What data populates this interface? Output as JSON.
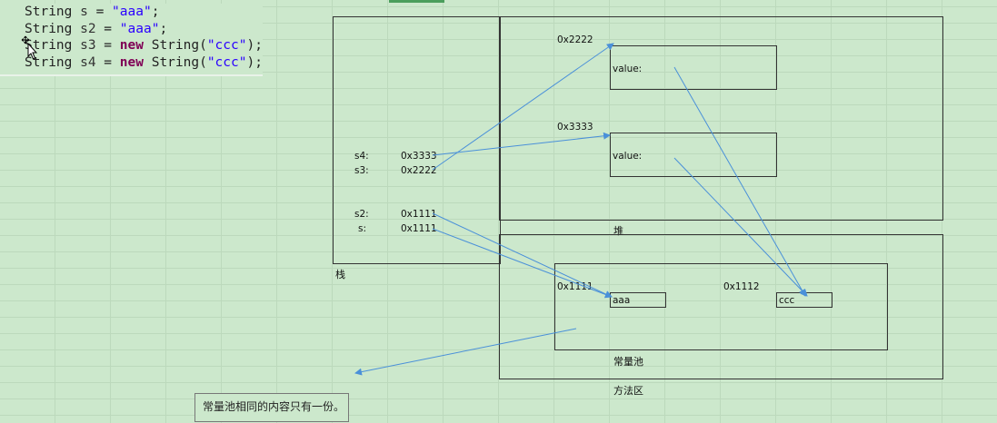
{
  "code": {
    "lines": [
      [
        {
          "t": "String ",
          "c": ""
        },
        {
          "t": "s",
          "c": "var"
        },
        {
          "t": " = ",
          "c": ""
        },
        {
          "t": "\"aaa\"",
          "c": "str"
        },
        {
          "t": ";",
          "c": ""
        }
      ],
      [
        {
          "t": "String ",
          "c": ""
        },
        {
          "t": "s2",
          "c": "var"
        },
        {
          "t": " = ",
          "c": ""
        },
        {
          "t": "\"aaa\"",
          "c": "str"
        },
        {
          "t": ";",
          "c": ""
        }
      ],
      [
        {
          "t": "String ",
          "c": ""
        },
        {
          "t": "s3",
          "c": "var"
        },
        {
          "t": " = ",
          "c": ""
        },
        {
          "t": "new",
          "c": "kw"
        },
        {
          "t": " String(",
          "c": ""
        },
        {
          "t": "\"ccc\"",
          "c": "str"
        },
        {
          "t": ");",
          "c": ""
        }
      ],
      [
        {
          "t": "String ",
          "c": ""
        },
        {
          "t": "s4",
          "c": "var"
        },
        {
          "t": " = ",
          "c": ""
        },
        {
          "t": "new",
          "c": "kw"
        },
        {
          "t": " String(",
          "c": ""
        },
        {
          "t": "\"ccc\"",
          "c": "str"
        },
        {
          "t": ");",
          "c": ""
        }
      ]
    ]
  },
  "stack": {
    "label": "栈",
    "vars": [
      {
        "name": "s4:",
        "addr": "0x3333"
      },
      {
        "name": "s3:",
        "addr": "0x2222"
      },
      {
        "name": "s2:",
        "addr": "0x1111"
      },
      {
        "name": "s:",
        "addr": "0x1111"
      }
    ]
  },
  "heap": {
    "label": "堆",
    "objects": [
      {
        "addr": "0x2222",
        "field": "value:"
      },
      {
        "addr": "0x3333",
        "field": "value:"
      }
    ]
  },
  "method_area": {
    "label": "方法区",
    "constant_pool": {
      "label": "常量池",
      "entries": [
        {
          "addr": "0x1111",
          "value": "aaa"
        },
        {
          "addr": "0x1112",
          "value": "ccc"
        }
      ]
    }
  },
  "note": "常量池相同的内容只有一份。",
  "colors": {
    "arrow": "#4a90d9",
    "box": "#333333",
    "background": "#cce8cc"
  }
}
